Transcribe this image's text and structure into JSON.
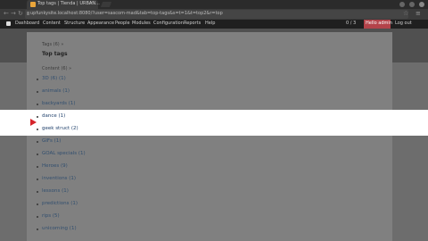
{
  "browser": {
    "tab_title": "Top tags | Tienda | URBAN...",
    "tab_close": "×",
    "url": "upfunkysite.localhost:8080/?user=sascom-mad&tab=top-tags&s=t=1&t=top2&r=top",
    "zoom_label": "",
    "nav_back": "←",
    "nav_forward": "→",
    "nav_reload": "↻",
    "star_icon": "☆",
    "menu_icon": "≡"
  },
  "toolbar": {
    "items": [
      "Dashboard",
      "Content",
      "Structure",
      "Appearance",
      "People",
      "Modules",
      "Configuration",
      "Reports",
      "Help"
    ],
    "right_count": "0 / 3",
    "user_label": "Hello admin",
    "logout": "Log out"
  },
  "page": {
    "vocab_label": "Tags (6) »",
    "term_title": "Top tags",
    "content_label": "Content (6) »",
    "terms": [
      "3D (6) (1)",
      "animals (1)",
      "backyards (1)",
      "dance (1)",
      "geek struct (2)",
      "GIFs (1)",
      "GOAL specials (1)",
      "Heroes (9)",
      "inventions (1)",
      "lessons (1)",
      "predictions (1)",
      "rips (5)",
      "unicorning (1)"
    ]
  }
}
